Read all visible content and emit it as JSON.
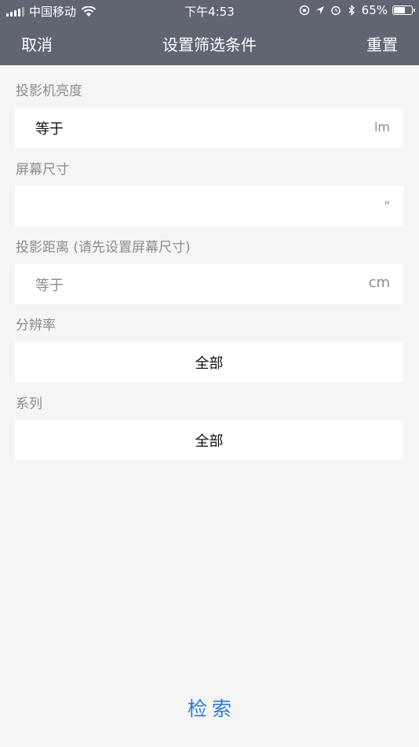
{
  "status_bar": {
    "carrier": "中国移动",
    "time": "下午4:53",
    "battery_percent": "65%",
    "battery_level": 0.65
  },
  "nav": {
    "cancel_label": "取消",
    "title": "设置筛选条件",
    "reset_label": "重置"
  },
  "filters": {
    "brightness": {
      "label": "投影机亮度",
      "prefix": "等于",
      "unit": "lm"
    },
    "screen_size": {
      "label": "屏幕尺寸",
      "unit": "\""
    },
    "projection_distance": {
      "label": "投影距离 (请先设置屏幕尺寸)",
      "prefix": "等于",
      "unit": "cm"
    },
    "resolution": {
      "label": "分辨率",
      "value": "全部"
    },
    "series": {
      "label": "系列",
      "value": "全部"
    }
  },
  "search_label": "检索"
}
